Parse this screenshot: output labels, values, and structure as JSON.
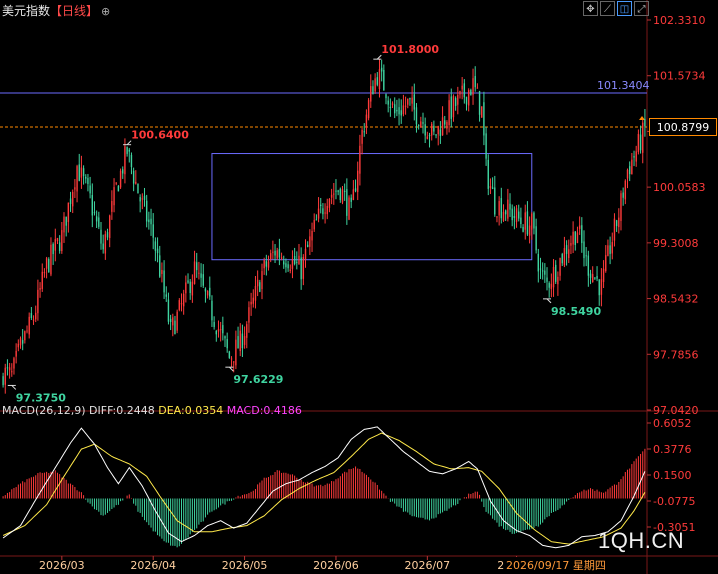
{
  "header": {
    "title": "美元指数",
    "period": "【日线】",
    "settings_icon": "gear-icon"
  },
  "toolbar": {
    "tools": [
      {
        "name": "crosshair-tool-icon",
        "glyph": "✥"
      },
      {
        "name": "draw-line-tool-icon",
        "glyph": "⟋"
      },
      {
        "name": "layout-tool-icon",
        "glyph": "◫"
      },
      {
        "name": "expand-tool-icon",
        "glyph": "⤢"
      }
    ]
  },
  "macd": {
    "label": "MACD(26,12,9)",
    "diff_label": "DIFF:0.2448",
    "dea_label": "DEA:0.0354",
    "macd_label": "MACD:0.4186"
  },
  "current_price_label": "100.8799",
  "current_date_label": "2026/09/17 星期四",
  "watermark": "1QH.CN",
  "colors": {
    "up": "#ff3b3b",
    "down": "#3fd4a0",
    "macd_up": "#ff3b3b",
    "macd_down": "#3fd4a0",
    "diff_line": "#ffffff",
    "dea_line": "#ffe94a",
    "resistance_line": "#6b6bff",
    "current_price_line": "#ff8a00",
    "range_box": "#6b6bff",
    "high_label": "#ff3b3b",
    "low_label": "#3fd4a0",
    "axis_text": "#ff3b3b"
  },
  "chart_data": {
    "type": "candlestick",
    "price_axis_ticks": [
      "102.3310",
      "101.5734",
      "100.8158",
      "100.0583",
      "99.3008",
      "98.5432",
      "97.7856",
      "97.0420"
    ],
    "price_range": [
      97.042,
      102.331
    ],
    "resistance_line": {
      "value": 101.3404,
      "label": "101.3404"
    },
    "current_price": 100.8799,
    "range_box": {
      "start_index": 96,
      "end_index": 243,
      "top": 100.52,
      "bottom": 99.08
    },
    "annotations": [
      {
        "label": "100.6400",
        "value": 100.64,
        "index": 57,
        "kind": "high"
      },
      {
        "label": "101.8000",
        "value": 101.8,
        "index": 172,
        "kind": "high"
      },
      {
        "label": "97.3750",
        "value": 97.375,
        "index": 4,
        "kind": "low"
      },
      {
        "label": "97.6229",
        "value": 97.6229,
        "index": 104,
        "kind": "low"
      },
      {
        "label": "98.5490",
        "value": 98.549,
        "index": 250,
        "kind": "low"
      }
    ],
    "x_axis_labels": [
      {
        "label": "2026/03",
        "index": 27
      },
      {
        "label": "2026/04",
        "index": 69
      },
      {
        "label": "2026/05",
        "index": 111
      },
      {
        "label": "2026/06",
        "index": 153
      },
      {
        "label": "2026/07",
        "index": 195
      },
      {
        "label": "2026/0",
        "index": 236
      }
    ],
    "close_path": [
      [
        0,
        97.55
      ],
      [
        4,
        97.5
      ],
      [
        8,
        97.9
      ],
      [
        14,
        98.3
      ],
      [
        20,
        99.0
      ],
      [
        27,
        99.4
      ],
      [
        34,
        100.35
      ],
      [
        40,
        99.9
      ],
      [
        46,
        99.2
      ],
      [
        52,
        100.05
      ],
      [
        57,
        100.55
      ],
      [
        63,
        99.9
      ],
      [
        69,
        99.4
      ],
      [
        73,
        98.8
      ],
      [
        77,
        98.1
      ],
      [
        82,
        98.45
      ],
      [
        88,
        98.95
      ],
      [
        94,
        98.5
      ],
      [
        99,
        98.15
      ],
      [
        104,
        97.75
      ],
      [
        109,
        97.95
      ],
      [
        114,
        98.4
      ],
      [
        119,
        98.9
      ],
      [
        125,
        99.2
      ],
      [
        131,
        99.1
      ],
      [
        137,
        98.95
      ],
      [
        143,
        99.5
      ],
      [
        149,
        99.95
      ],
      [
        155,
        100.05
      ],
      [
        160,
        99.7
      ],
      [
        165,
        100.8
      ],
      [
        170,
        101.45
      ],
      [
        172,
        101.6
      ],
      [
        176,
        101.4
      ],
      [
        180,
        101.05
      ],
      [
        186,
        101.2
      ],
      [
        192,
        101.0
      ],
      [
        198,
        100.75
      ],
      [
        204,
        101.05
      ],
      [
        210,
        101.25
      ],
      [
        216,
        101.45
      ],
      [
        220,
        101.1
      ],
      [
        222,
        100.3
      ],
      [
        226,
        99.85
      ],
      [
        232,
        99.75
      ],
      [
        238,
        99.6
      ],
      [
        243,
        99.55
      ],
      [
        247,
        98.9
      ],
      [
        250,
        98.75
      ],
      [
        254,
        98.95
      ],
      [
        259,
        99.25
      ],
      [
        264,
        99.5
      ],
      [
        268,
        99.05
      ],
      [
        272,
        98.85
      ],
      [
        275,
        98.7
      ],
      [
        279,
        99.25
      ],
      [
        283,
        99.7
      ],
      [
        287,
        100.3
      ],
      [
        291,
        100.55
      ],
      [
        295,
        100.85
      ]
    ],
    "macd_axis_ticks": [
      "0.6052",
      "0.3776",
      "0.1500",
      "-0.0775",
      "-0.3051"
    ],
    "macd_range": [
      -0.45,
      0.62
    ],
    "diff_path": [
      [
        0,
        -0.32
      ],
      [
        8,
        -0.22
      ],
      [
        16,
        0.02
      ],
      [
        24,
        0.25
      ],
      [
        31,
        0.45
      ],
      [
        36,
        0.57
      ],
      [
        42,
        0.44
      ],
      [
        48,
        0.25
      ],
      [
        53,
        0.12
      ],
      [
        58,
        0.25
      ],
      [
        64,
        0.1
      ],
      [
        70,
        -0.1
      ],
      [
        76,
        -0.28
      ],
      [
        82,
        -0.35
      ],
      [
        88,
        -0.3
      ],
      [
        94,
        -0.22
      ],
      [
        100,
        -0.18
      ],
      [
        106,
        -0.24
      ],
      [
        112,
        -0.2
      ],
      [
        118,
        -0.07
      ],
      [
        124,
        0.06
      ],
      [
        130,
        0.12
      ],
      [
        136,
        0.15
      ],
      [
        142,
        0.21
      ],
      [
        148,
        0.26
      ],
      [
        154,
        0.33
      ],
      [
        160,
        0.48
      ],
      [
        166,
        0.56
      ],
      [
        172,
        0.58
      ],
      [
        178,
        0.48
      ],
      [
        184,
        0.38
      ],
      [
        190,
        0.3
      ],
      [
        196,
        0.22
      ],
      [
        202,
        0.2
      ],
      [
        208,
        0.24
      ],
      [
        214,
        0.3
      ],
      [
        218,
        0.24
      ],
      [
        224,
        -0.02
      ],
      [
        230,
        -0.18
      ],
      [
        236,
        -0.26
      ],
      [
        242,
        -0.3
      ],
      [
        248,
        -0.38
      ],
      [
        254,
        -0.4
      ],
      [
        260,
        -0.38
      ],
      [
        266,
        -0.31
      ],
      [
        272,
        -0.3
      ],
      [
        278,
        -0.27
      ],
      [
        284,
        -0.18
      ],
      [
        290,
        0.02
      ],
      [
        295,
        0.22
      ]
    ],
    "dea_path": [
      [
        0,
        -0.3
      ],
      [
        10,
        -0.22
      ],
      [
        20,
        -0.05
      ],
      [
        28,
        0.18
      ],
      [
        36,
        0.4
      ],
      [
        42,
        0.44
      ],
      [
        50,
        0.34
      ],
      [
        58,
        0.28
      ],
      [
        66,
        0.18
      ],
      [
        72,
        0.02
      ],
      [
        80,
        -0.18
      ],
      [
        88,
        -0.27
      ],
      [
        96,
        -0.27
      ],
      [
        104,
        -0.24
      ],
      [
        112,
        -0.22
      ],
      [
        120,
        -0.14
      ],
      [
        128,
        -0.01
      ],
      [
        136,
        0.08
      ],
      [
        144,
        0.15
      ],
      [
        152,
        0.21
      ],
      [
        160,
        0.34
      ],
      [
        168,
        0.48
      ],
      [
        174,
        0.53
      ],
      [
        182,
        0.47
      ],
      [
        190,
        0.38
      ],
      [
        198,
        0.28
      ],
      [
        206,
        0.24
      ],
      [
        214,
        0.25
      ],
      [
        220,
        0.22
      ],
      [
        228,
        0.08
      ],
      [
        236,
        -0.12
      ],
      [
        244,
        -0.25
      ],
      [
        252,
        -0.35
      ],
      [
        260,
        -0.37
      ],
      [
        268,
        -0.34
      ],
      [
        276,
        -0.31
      ],
      [
        284,
        -0.24
      ],
      [
        290,
        -0.1
      ],
      [
        295,
        0.05
      ]
    ],
    "macd_hist_path": [
      [
        0,
        0.02
      ],
      [
        8,
        0.12
      ],
      [
        16,
        0.2
      ],
      [
        24,
        0.22
      ],
      [
        30,
        0.13
      ],
      [
        36,
        0.05
      ],
      [
        40,
        -0.05
      ],
      [
        46,
        -0.14
      ],
      [
        52,
        -0.06
      ],
      [
        58,
        0.03
      ],
      [
        62,
        -0.1
      ],
      [
        68,
        -0.24
      ],
      [
        74,
        -0.35
      ],
      [
        80,
        -0.4
      ],
      [
        84,
        -0.33
      ],
      [
        90,
        -0.22
      ],
      [
        96,
        -0.1
      ],
      [
        102,
        -0.04
      ],
      [
        108,
        0.02
      ],
      [
        114,
        0.05
      ],
      [
        120,
        0.16
      ],
      [
        126,
        0.22
      ],
      [
        132,
        0.2
      ],
      [
        138,
        0.14
      ],
      [
        144,
        0.1
      ],
      [
        150,
        0.12
      ],
      [
        156,
        0.2
      ],
      [
        162,
        0.26
      ],
      [
        168,
        0.18
      ],
      [
        174,
        0.06
      ],
      [
        178,
        -0.02
      ],
      [
        184,
        -0.1
      ],
      [
        190,
        -0.16
      ],
      [
        196,
        -0.17
      ],
      [
        202,
        -0.12
      ],
      [
        208,
        -0.05
      ],
      [
        214,
        0.03
      ],
      [
        218,
        0.06
      ],
      [
        222,
        -0.1
      ],
      [
        228,
        -0.22
      ],
      [
        234,
        -0.28
      ],
      [
        240,
        -0.26
      ],
      [
        246,
        -0.22
      ],
      [
        252,
        -0.12
      ],
      [
        258,
        -0.05
      ],
      [
        264,
        0.05
      ],
      [
        270,
        0.08
      ],
      [
        276,
        0.05
      ],
      [
        282,
        0.12
      ],
      [
        288,
        0.25
      ],
      [
        295,
        0.4
      ]
    ],
    "candle_count": 296
  }
}
